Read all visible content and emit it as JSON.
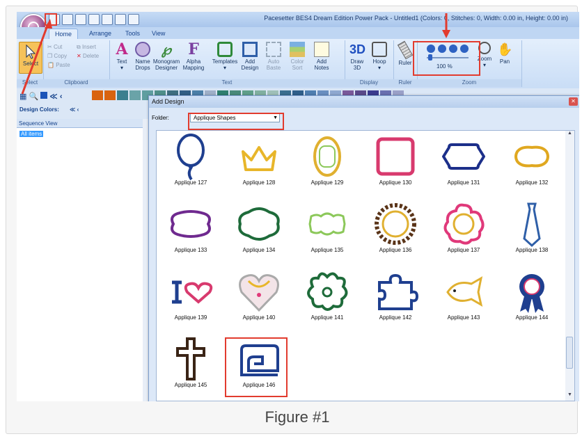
{
  "caption": "Figure #1",
  "window": {
    "title": "Pacesetter BES4 Dream Edition Power Pack - Untitled1 (Colors: 0, Stitches: 0, Width: 0.00 in, Height: 0.00 in)"
  },
  "tabs": [
    "Home",
    "Arrange",
    "Tools",
    "View"
  ],
  "ribbon": {
    "select": {
      "label": "Select",
      "group": "Select"
    },
    "clipboard": {
      "cut": "Cut",
      "copy": "Copy",
      "paste": "Paste",
      "insert": "Insert",
      "delete": "Delete",
      "group": "Clipboard"
    },
    "text": {
      "buttons": [
        {
          "label": "Text",
          "sub": ""
        },
        {
          "label": "Name",
          "sub": "Drops"
        },
        {
          "label": "Monogram",
          "sub": "Designer"
        },
        {
          "label": "Alpha",
          "sub": "Mapping"
        },
        {
          "label": "Templates",
          "sub": ""
        },
        {
          "label": "Add",
          "sub": "Design"
        },
        {
          "label": "Auto",
          "sub": "Baste"
        },
        {
          "label": "Color",
          "sub": "Sort"
        },
        {
          "label": "Add",
          "sub": "Notes"
        }
      ],
      "group": "Text"
    },
    "display": {
      "draw": "Draw",
      "draw_sub": "3D",
      "hoop": "Hoop",
      "group": "Display"
    },
    "ruler": {
      "label": "Ruler",
      "group": "Ruler"
    },
    "zoom": {
      "percent": "100 %",
      "zoom": "Zoom",
      "pan": "Pan",
      "group": "Zoom"
    }
  },
  "left_panel": {
    "design_colors": "Design Colors:",
    "sequence_view": "Sequence View",
    "all_items": "All items"
  },
  "dialog": {
    "title": "Add Design",
    "folder_label": "Folder:",
    "folder_value": "Applique Shapes",
    "items": [
      {
        "label": "Applique 127",
        "shape": "balloon",
        "color": "#1f3f8f"
      },
      {
        "label": "Applique 128",
        "shape": "crown",
        "color": "#e8b62a"
      },
      {
        "label": "Applique 129",
        "shape": "oval-frame",
        "color": "#e0b030"
      },
      {
        "label": "Applique 130",
        "shape": "square",
        "color": "#d83a6e"
      },
      {
        "label": "Applique 131",
        "shape": "plaque",
        "color": "#1c2f8a"
      },
      {
        "label": "Applique 132",
        "shape": "cloud-plaque",
        "color": "#e0a820"
      },
      {
        "label": "Applique 133",
        "shape": "wide-plaque",
        "color": "#6f2a8f"
      },
      {
        "label": "Applique 134",
        "shape": "scallop",
        "color": "#1e6b3a"
      },
      {
        "label": "Applique 135",
        "shape": "fancy-plaque",
        "color": "#8cc85a"
      },
      {
        "label": "Applique 136",
        "shape": "ring",
        "color": "#5a3418"
      },
      {
        "label": "Applique 137",
        "shape": "flower",
        "color": "#e0397a"
      },
      {
        "label": "Applique 138",
        "shape": "tie",
        "color": "#2f5fa8"
      },
      {
        "label": "Applique 139",
        "shape": "i-heart",
        "color": "#1f3f8f"
      },
      {
        "label": "Applique 140",
        "shape": "heart-dress",
        "color": "#aaaaaa"
      },
      {
        "label": "Applique 141",
        "shape": "clover",
        "color": "#1e6b3a"
      },
      {
        "label": "Applique 142",
        "shape": "puzzle",
        "color": "#1f3f8f"
      },
      {
        "label": "Applique 143",
        "shape": "fish",
        "color": "#e0b030"
      },
      {
        "label": "Applique 144",
        "shape": "ribbon",
        "color": "#1f3f8f"
      },
      {
        "label": "Applique 145",
        "shape": "cross",
        "color": "#3a2416"
      },
      {
        "label": "Applique 146",
        "shape": "sewing-machine",
        "color": "#1f3f8f"
      }
    ]
  },
  "colors": {
    "highlight": "#e23b2e",
    "palette": [
      "#d9630f",
      "#d9630f",
      "#3b7f8f",
      "#6aa3a8",
      "#5f9ea0",
      "#4f8f8a",
      "#3f6f80",
      "#305e85",
      "#4a7fa8",
      "#9fb0c8",
      "#2e7f6f",
      "#4a8a7a",
      "#5f9f8a",
      "#80b0a0",
      "#9fc0b8",
      "#3b6f8f",
      "#2f5f8a",
      "#4f7fb0",
      "#6a8fc0",
      "#8ea8d0",
      "#7a5a9a",
      "#5a4a8a",
      "#3b3b8f",
      "#6a70b0",
      "#9aa0c8"
    ]
  }
}
